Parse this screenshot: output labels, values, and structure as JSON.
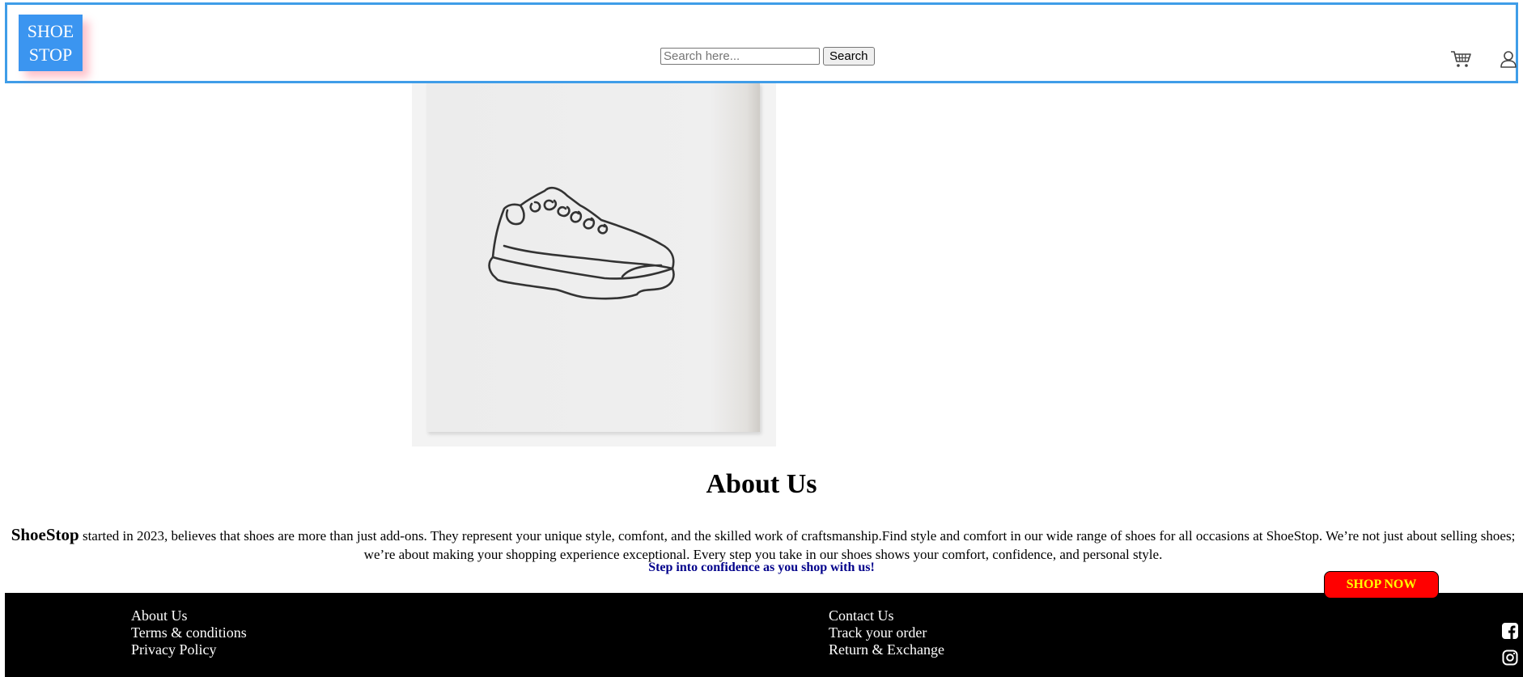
{
  "header": {
    "logo_line1": "SHOE",
    "logo_line2": "STOP",
    "search_placeholder": "Search here...",
    "search_button": "Search",
    "cart_icon": "cart-icon",
    "user_icon": "user-icon"
  },
  "hero": {
    "image_icon": "sneaker-line-drawing"
  },
  "about": {
    "title": "About Us",
    "brand": "ShoeStop",
    "text": "started in 2023, believes that shoes are more than just add-ons. They represent your unique style, comfont, and the skilled work of craftsmanship.Find style and comfort in our wide range of shoes for all occasions at ShoeStop. We’re not just about selling shoes; we’re about making your shopping experience exceptional. Every step you take in our shoes shows your comfort, confidence, and personal style.",
    "tagline": "Step into confidence as you shop with us!"
  },
  "cta": {
    "shop_now": "SHOP NOW"
  },
  "footer": {
    "left_links": [
      "About Us",
      "Terms & conditions",
      "Privacy Policy"
    ],
    "right_links": [
      "Contact Us",
      "Track your order",
      "Return & Exchange"
    ],
    "social_icons": [
      "facebook-icon",
      "instagram-icon"
    ]
  },
  "colors": {
    "header_border": "#3f9de8",
    "logo_bg": "#3b95f0",
    "footer_bg": "#000000",
    "tagline": "#00008b",
    "shop_now_bg": "#ff0000",
    "shop_now_text": "#ffff00"
  }
}
